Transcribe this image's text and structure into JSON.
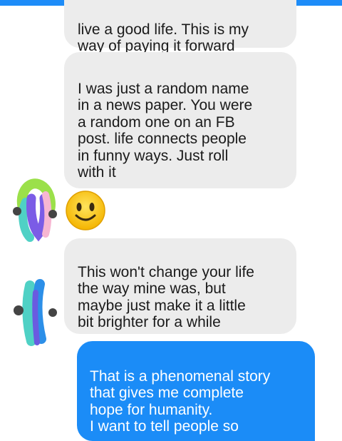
{
  "messages": [
    {
      "from": "them",
      "text": "live a good life.  This is my\nway of paying it forward"
    },
    {
      "from": "them",
      "text": "I was just a random name\nin a news paper.  You were\na random one on an FB\npost.  life connects people\nin funny ways.  Just roll\nwith it"
    },
    {
      "from": "them",
      "emoji": "smiling-face"
    },
    {
      "from": "them",
      "text": "This won't change your life\nthe way mine was, but\nmaybe just make it a little\nbit brighter for a while"
    },
    {
      "from": "me",
      "text": "That is a phenomenal story\nthat gives me complete\nhope for humanity.\nI want to tell people so"
    }
  ],
  "colors": {
    "incoming_bubble": "#ececec",
    "outgoing_bubble": "#1b8cf7",
    "accent": "#1d8cf8"
  }
}
